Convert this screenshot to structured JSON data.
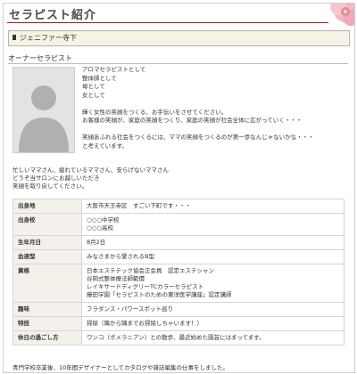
{
  "page": {
    "title": "セラピスト紹介",
    "name_label": "ジェニファー寺下",
    "section_title": "オーナーセラピスト"
  },
  "intro_lines": [
    "アロマセラピストとして",
    "整体師として",
    "母として",
    "女として",
    "",
    "輝く女性の笑顔をつくる、お手伝いをさせてください。",
    "お客様の笑顔が、家庭の笑顔をつくり、家庭の笑顔が社会全体に広がっていく・・・",
    "",
    "笑顔あふれる社会をつくるには、ママの笑顔をつくるのが第一歩なんじゃないかな・・・",
    "と考えています。"
  ],
  "intro2_lines": [
    "忙しいママさん、疲れているママさん、安らげないママさん",
    "どうぞ当サロンにお越しいただき",
    "笑顔を取り戻してください。"
  ],
  "profile": [
    {
      "key": "出身地",
      "values": [
        "大阪市天王寺区　すごい下町です・・・"
      ]
    },
    {
      "key": "出身校",
      "values": [
        "○○○中学校",
        "○○○高校"
      ]
    },
    {
      "key": "生年月日",
      "values": [
        "8月2日"
      ]
    },
    {
      "key": "血液型",
      "values": [
        "みなさまから愛されるB型"
      ]
    },
    {
      "key": "資格",
      "values": [
        "日本エステテック協会正会員　認定エステシャン",
        "谷岡式整体療法師範價",
        "レイキサードディグリーTCカラーセラピスト",
        "藤田学園「セラピストのための東洋医学講座」認定講師"
      ]
    },
    {
      "key": "趣味",
      "values": [
        "フラダンス・パワースポット巡り"
      ]
    },
    {
      "key": "特技",
      "values": [
        "掃除（隅から隅までお掃除しちゃいます！）"
      ]
    },
    {
      "key": "休日の過ごし方",
      "values": [
        "ワンコ（ポメラニアン）との散歩、最近始めた園芸にはまってます。"
      ]
    }
  ],
  "footer_text": "青門学校卒業後、10年間デザイナーとしてカタログや雑誌編集の仕事をしました。",
  "colors": {
    "accent": "#8b1b2c",
    "name_box_bg": "#f6f3e6",
    "key_cell_bg": "#f3f1ea"
  }
}
